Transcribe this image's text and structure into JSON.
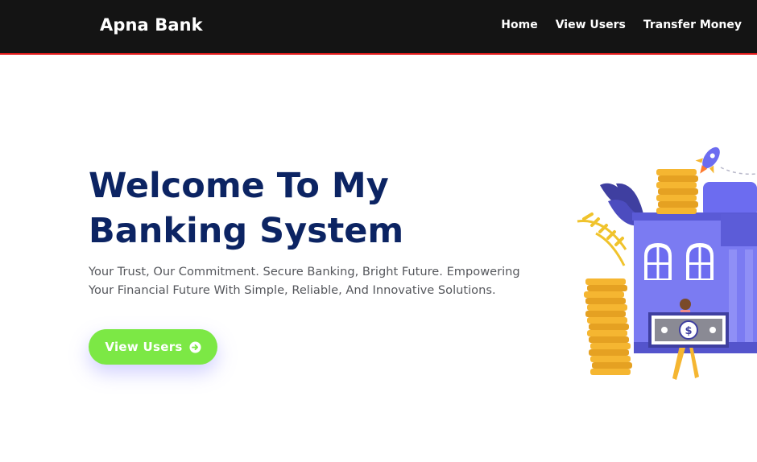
{
  "navbar": {
    "brand": "Apna Bank",
    "links": [
      "Home",
      "View Users",
      "Transfer Money"
    ]
  },
  "hero": {
    "title": "Welcome To My Banking System",
    "subtitle": "Your Trust, Our Commitment. Secure Banking, Bright Future. Empowering Your Financial Future With Simple, Reliable, And Innovative Solutions.",
    "cta_label": "View Users"
  },
  "icons": {
    "cta": "arrow-circle-right-icon",
    "illustration": "bank-building-illustration"
  },
  "colors": {
    "navbar_bg": "#141414",
    "navbar_border": "#e21b1b",
    "title": "#0c2463",
    "subtitle": "#55575c",
    "cta_bg": "#7ce845",
    "illustration_primary": "#6c6cf0"
  }
}
